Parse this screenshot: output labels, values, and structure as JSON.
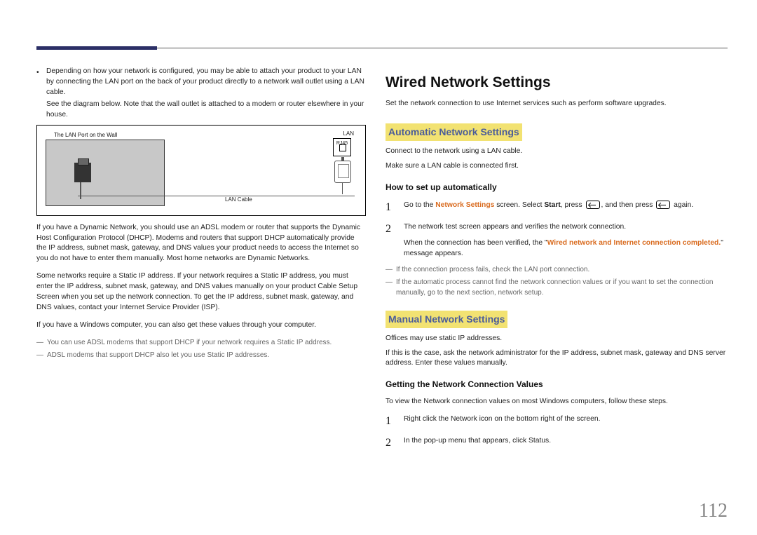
{
  "left": {
    "bullet": "Depending on how your network is configured, you may be able to attach your product to your LAN by connecting the LAN port on the back of your product directly to a network wall outlet using a LAN cable.",
    "bullet_sub": "See the diagram below. Note that the wall outlet is attached to a modem or router elsewhere in your house.",
    "diagram": {
      "wall_label": "The LAN Port on the Wall",
      "cable_label": "LAN Cable",
      "lan_label": "LAN",
      "rj45": "RJ45"
    },
    "p1": "If you have a Dynamic Network, you should use an ADSL modem or router that supports the Dynamic Host Configuration Protocol (DHCP). Modems and routers that support DHCP automatically provide the IP address, subnet mask, gateway, and DNS values your product needs to access the Internet so you do not have to enter them manually. Most home networks are Dynamic Networks.",
    "p2": "Some networks require a Static IP address. If your network requires a Static IP address, you must enter the IP address, subnet mask, gateway, and DNS values manually on your product Cable Setup Screen when you set up the network connection. To get the IP address, subnet mask, gateway, and DNS values, contact your Internet Service Provider (ISP).",
    "p3": "If you have a Windows computer, you can also get these values through your computer.",
    "note1": "You can use ADSL modems that support DHCP if your network requires a Static IP address.",
    "note2": "ADSL modems that support DHCP also let you use Static IP addresses."
  },
  "right": {
    "h1": "Wired Network Settings",
    "intro": "Set the network connection to use Internet services such as perform software upgrades.",
    "auto_h2": "Automatic Network Settings",
    "auto_p1": "Connect to the network using a LAN cable.",
    "auto_p2": "Make sure a LAN cable is connected first.",
    "auto_h3": "How to set up automatically",
    "auto_step1_a": "Go to the ",
    "auto_step1_ns": "Network Settings",
    "auto_step1_b": " screen. Select ",
    "auto_step1_start": "Start",
    "auto_step1_c": ", press ",
    "auto_step1_d": ", and then press ",
    "auto_step1_e": " again.",
    "auto_step2_a": "The network test screen appears and verifies the network connection.",
    "auto_step2_b_pre": "When the connection has been verified, the \"",
    "auto_step2_b_hl": "Wired network and Internet connection completed.",
    "auto_step2_b_post": "\" message appears.",
    "auto_note1": "If the connection process fails, check the LAN port connection.",
    "auto_note2": "If the automatic process cannot find the network connection values or if you want to set the connection manually, go to the next section, network setup.",
    "man_h2": "Manual Network Settings",
    "man_p1": "Offices may use static IP addresses.",
    "man_p2": "If this is the case, ask the network administrator for the IP address, subnet mask, gateway and DNS server address. Enter these values manually.",
    "man_h3": "Getting the Network Connection Values",
    "man_intro": "To view the Network connection values on most Windows computers, follow these steps.",
    "man_step1": "Right click the Network icon on the bottom right of the screen.",
    "man_step2": "In the pop-up menu that appears, click Status."
  },
  "page_number": "112"
}
